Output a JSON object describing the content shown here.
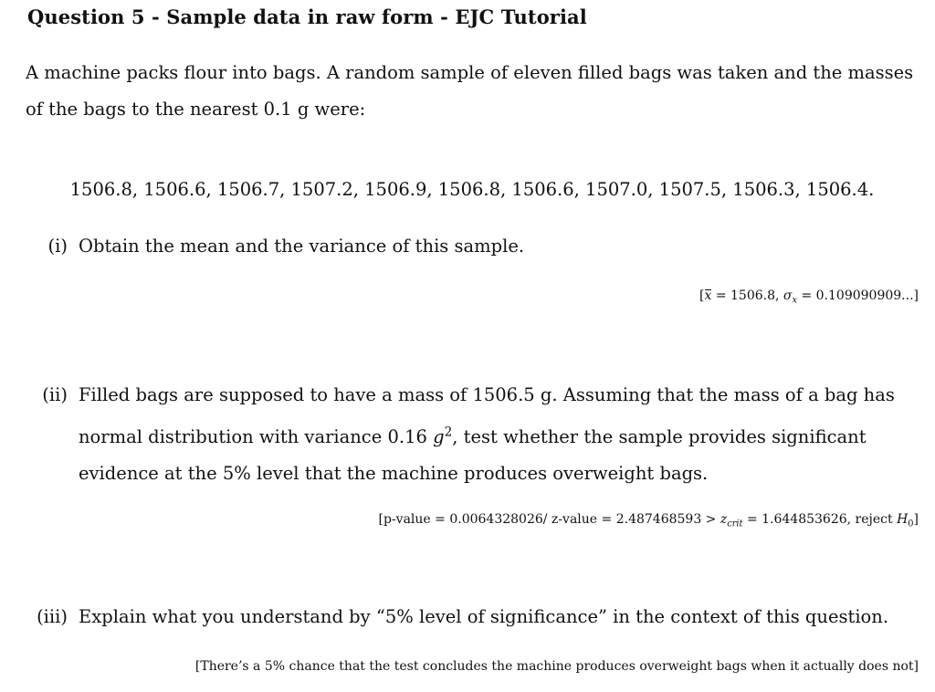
{
  "title": "Question 5 - Sample data in raw form - EJC Tutorial",
  "intro": "A machine packs flour into bags. A random sample of eleven filled bags was taken and the masses of the bags to the nearest 0.1 g were:",
  "sample": {
    "values": [
      "1506.8",
      "1506.6",
      "1506.7",
      "1507.2",
      "1506.9",
      "1506.8",
      "1506.6",
      "1507.0",
      "1507.5",
      "1506.3",
      "1506.4"
    ],
    "text": "1506.8, 1506.6, 1506.7, 1507.2, 1506.9, 1506.8, 1506.6, 1507.0, 1507.5, 1506.3, 1506.4."
  },
  "parts": [
    {
      "number": "(i)",
      "question": "Obtain the mean and the variance of this sample.",
      "answer": {
        "open": "[",
        "mean_symbol": "x",
        "mean_eq": " = 1506.8, ",
        "sigma_symbol": "σ",
        "sigma_sub": "x",
        "sigma_eq": " = 0.109090909...",
        "close": "]"
      }
    },
    {
      "number": "(ii)",
      "question_before_sup": "Filled bags are supposed to have a mass of 1506.5 g. Assuming that the mass of a bag has normal distribution with variance 0.16 ",
      "question_var_unit": "g",
      "question_sup": "2",
      "question_after_sup": ", test whether the sample provides significant evidence at the 5% level that the machine produces overweight bags.",
      "answer": {
        "open": "[p-value = 0.0064328026/ z-value = 2.487468593 > ",
        "zcrit_symbol": "z",
        "zcrit_sub": "crit",
        "mid": " = 1.644853626, reject ",
        "h_symbol": "H",
        "h_sub": "0",
        "close": "]"
      }
    },
    {
      "number": "(iii)",
      "question": "Explain what you understand by “5% level of significance” in the context of this question.",
      "answer": {
        "text": "[There’s a 5% chance that the test concludes the machine produces overweight bags when it actually does not]"
      }
    }
  ]
}
